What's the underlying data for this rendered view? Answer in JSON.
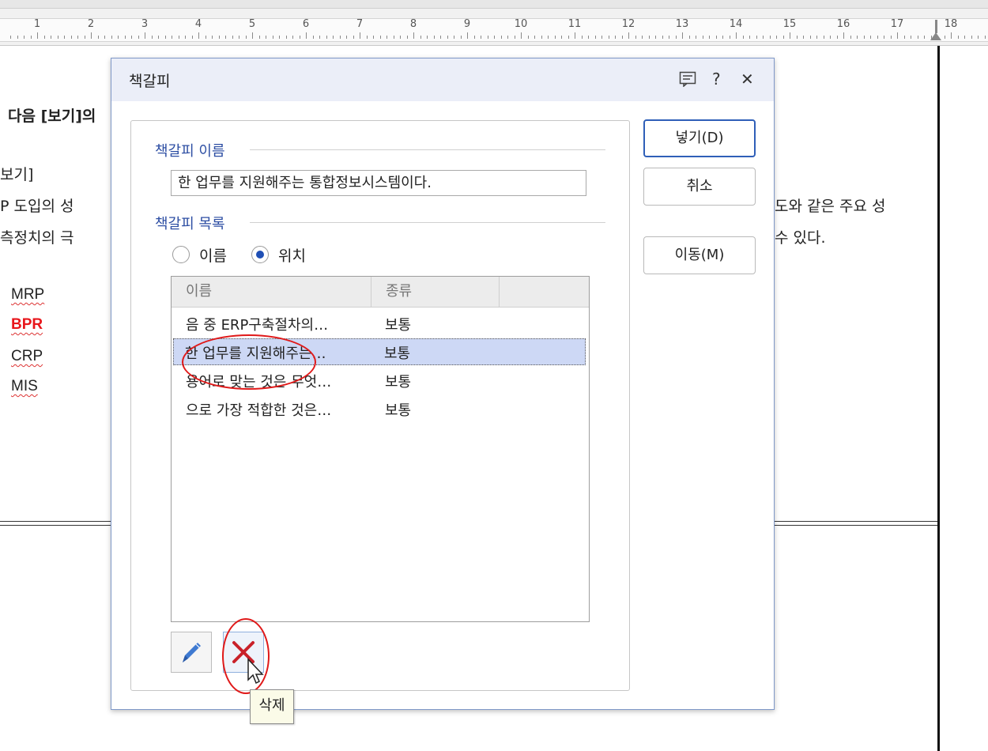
{
  "ruler": {
    "numbers": [
      "1",
      "2",
      "3",
      "4",
      "5",
      "6",
      "7",
      "8",
      "9",
      "10",
      "11",
      "12",
      "13",
      "14",
      "15",
      "16",
      "17",
      "18"
    ]
  },
  "document": {
    "question_fragment": "다음 [보기]의",
    "bracket_label": "보기]",
    "line1_left": "P 도입의 성",
    "line1_right": "도와 같은 주요 성",
    "line2_left": "측정치의 극",
    "line2_right": "수 있다.",
    "options": [
      "MRP",
      "BPR",
      "CRP",
      "MIS"
    ]
  },
  "dialog": {
    "title": "책갈피",
    "icons": {
      "memo": "memo-icon",
      "help": "?",
      "close": "✕"
    },
    "name_section_label": "책갈피 이름",
    "name_value": "한 업무를 지원해주는 통합정보시스템이다.",
    "list_section_label": "책갈피 목록",
    "sort_options": [
      {
        "label": "이름",
        "selected": false
      },
      {
        "label": "위치",
        "selected": true
      }
    ],
    "columns": [
      "이름",
      "종류",
      ""
    ],
    "rows": [
      {
        "name": "음 중 ERP구축절차의…",
        "type": "보통",
        "selected": false
      },
      {
        "name": "한 업무를 지원해주는…",
        "type": "보통",
        "selected": true
      },
      {
        "name": "용어로 맞는 것은 무엇…",
        "type": "보통",
        "selected": false
      },
      {
        "name": "으로 가장 적합한 것은…",
        "type": "보통",
        "selected": false
      }
    ],
    "buttons": {
      "insert": "넣기(D)",
      "cancel": "취소",
      "move": "이동(M)"
    },
    "delete_tooltip": "삭제"
  },
  "colors": {
    "accent": "#2f5fb8",
    "section_text": "#2d4ea3",
    "selection": "#cdd8f5",
    "highlight_red": "#e01919"
  }
}
